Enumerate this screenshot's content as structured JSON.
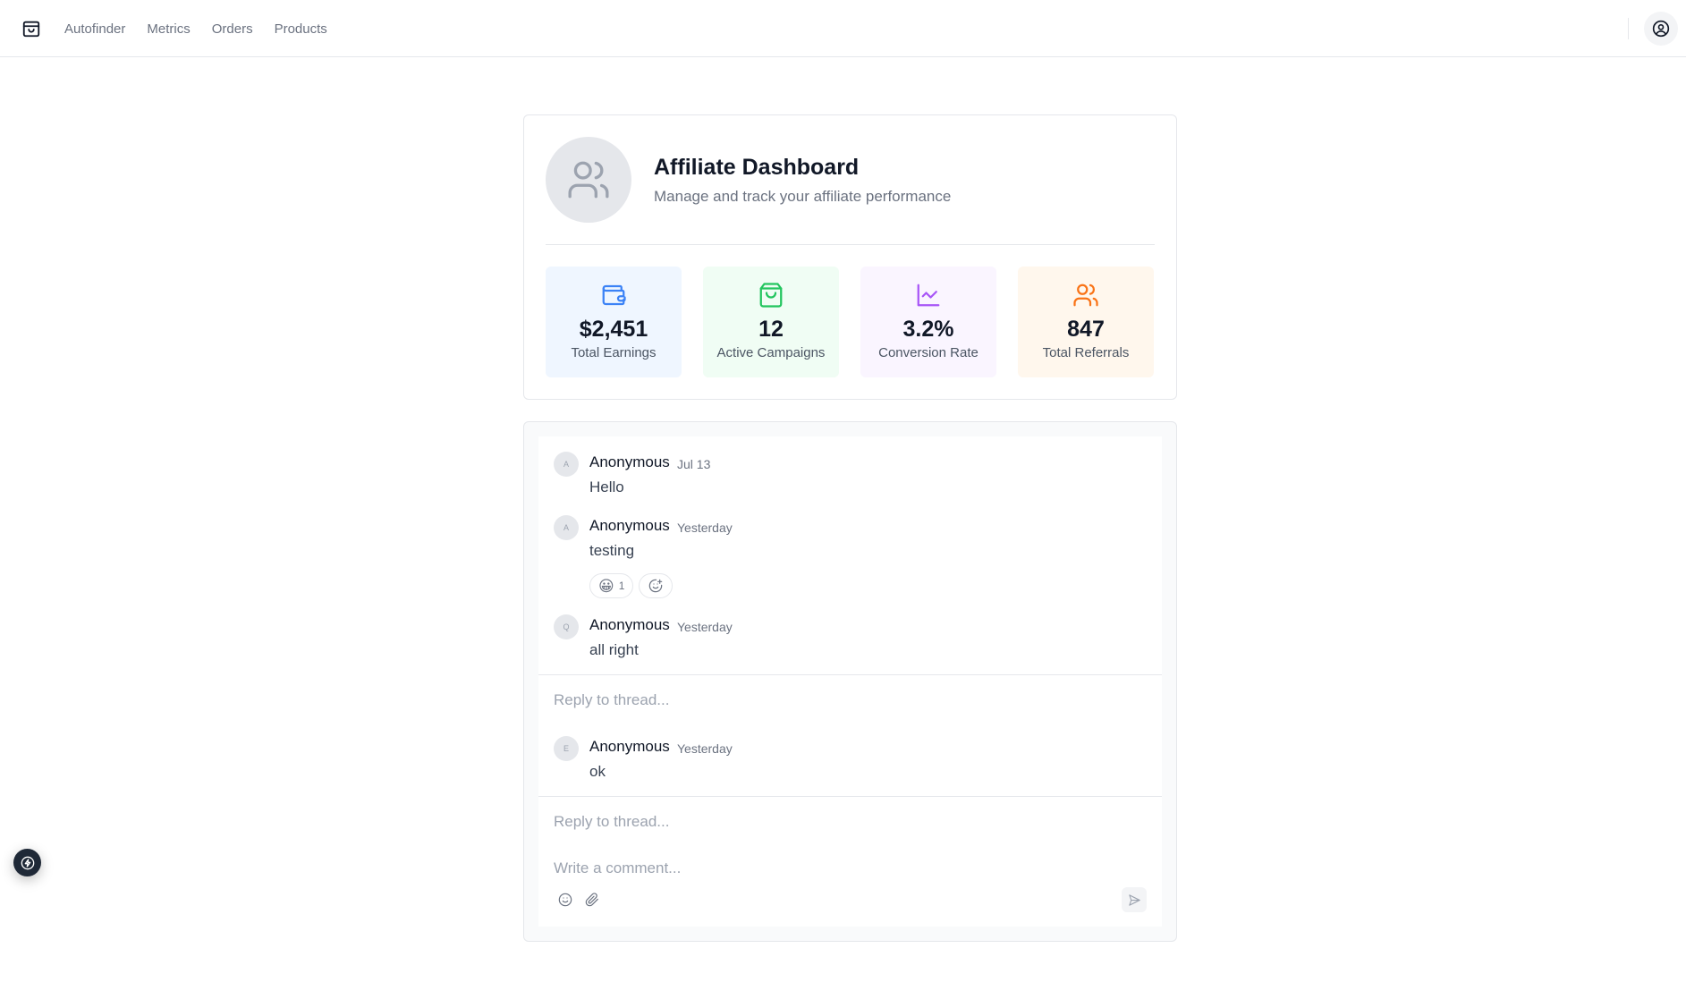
{
  "nav": {
    "logo_icon": "store-icon",
    "items": [
      {
        "label": "Autofinder"
      },
      {
        "label": "Metrics"
      },
      {
        "label": "Orders"
      },
      {
        "label": "Products"
      }
    ],
    "profile_icon": "user-circle-icon"
  },
  "dashboard": {
    "avatar_icon": "users-icon",
    "title": "Affiliate Dashboard",
    "subtitle": "Manage and track your affiliate performance",
    "stats": [
      {
        "icon": "wallet-icon",
        "value": "$2,451",
        "label": "Total Earnings",
        "bg": "#eff6ff",
        "color": "#3b82f6"
      },
      {
        "icon": "shopping-bag-icon",
        "value": "12",
        "label": "Active Campaigns",
        "bg": "#f0fdf4",
        "color": "#22c55e"
      },
      {
        "icon": "line-chart-icon",
        "value": "3.2%",
        "label": "Conversion Rate",
        "bg": "#faf5ff",
        "color": "#a855f7"
      },
      {
        "icon": "users-icon",
        "value": "847",
        "label": "Total Referrals",
        "bg": "#fff7ed",
        "color": "#f97316"
      }
    ]
  },
  "comments": {
    "threads": [
      {
        "messages": [
          {
            "initial": "A",
            "author": "Anonymous",
            "time": "Jul 13",
            "text": "Hello"
          },
          {
            "initial": "A",
            "author": "Anonymous",
            "time": "Yesterday",
            "text": "testing",
            "reactions": [
              {
                "emoji": "😀",
                "count": "1"
              }
            ],
            "add_reaction_icon": "smile-plus-icon"
          },
          {
            "initial": "Q",
            "author": "Anonymous",
            "time": "Yesterday",
            "text": "all right"
          }
        ],
        "reply_placeholder": "Reply to thread..."
      },
      {
        "messages": [
          {
            "initial": "E",
            "author": "Anonymous",
            "time": "Yesterday",
            "text": "ok"
          }
        ],
        "reply_placeholder": "Reply to thread..."
      }
    ],
    "new_comment_placeholder": "Write a comment...",
    "toolbar_icons": [
      "smile-icon",
      "paperclip-icon"
    ],
    "send_icon": "send-icon"
  },
  "fab": {
    "icon": "lightning-icon"
  }
}
